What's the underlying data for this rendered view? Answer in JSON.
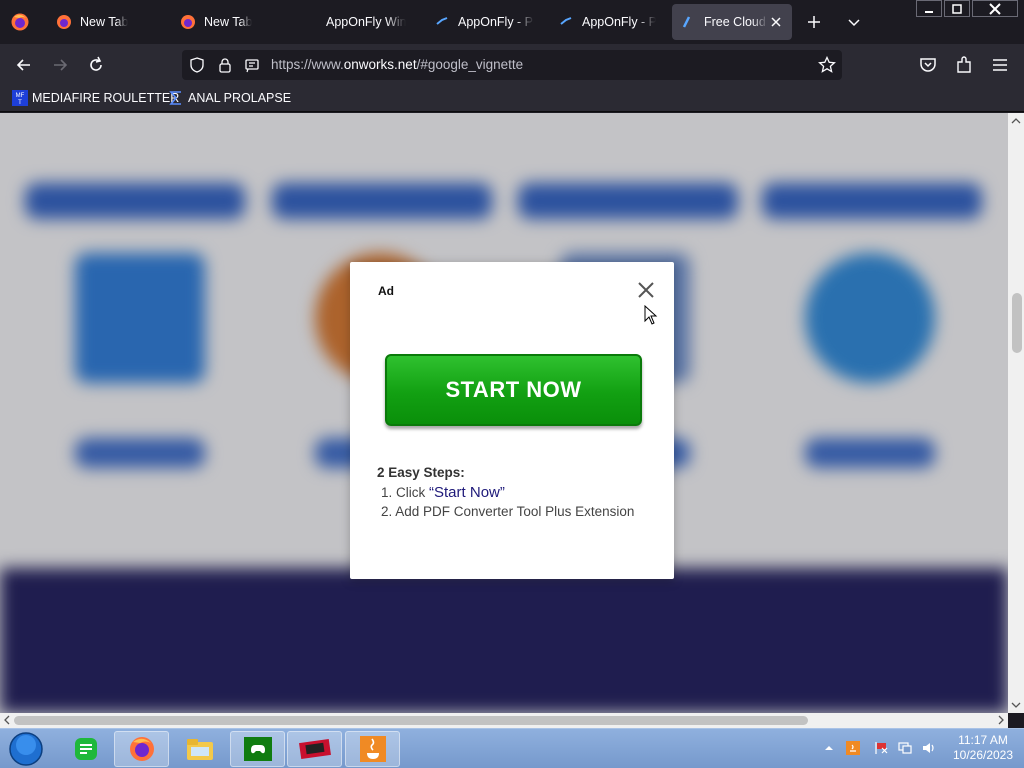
{
  "browser": {
    "tabs": [
      {
        "title": "New Tab",
        "icon": "firefox-icon",
        "active": false
      },
      {
        "title": "New Tab",
        "icon": "firefox-icon",
        "active": false
      },
      {
        "title": "AppOnFly Windows",
        "icon": "none",
        "active": false
      },
      {
        "title": "AppOnFly - Port",
        "icon": "apponfly-icon",
        "active": false
      },
      {
        "title": "AppOnFly - Port",
        "icon": "apponfly-icon",
        "active": false
      },
      {
        "title": "Free Cloud Hosting",
        "icon": "apponfly-icon",
        "active": true
      }
    ],
    "url_prefix": "https://www.",
    "url_host": "onworks.net",
    "url_suffix": "/#google_vignette",
    "bookmarks": [
      {
        "label": "MEDIAFIRE ROULETTER",
        "icon": "mft-icon"
      },
      {
        "label": "ANAL PROLAPSE",
        "icon": "sigma-icon"
      }
    ]
  },
  "ad_modal": {
    "ad_label": "Ad",
    "start_button": "START NOW",
    "steps_title": "2 Easy Steps:",
    "step1_prefix": "1. Click ",
    "step1_quote": "“Start Now”",
    "step2": "2. Add PDF Converter Tool Plus Extension"
  },
  "taskbar": {
    "apps": [
      "notes-icon",
      "firefox-icon",
      "file-explorer-icon",
      "xbox-icon",
      "media-icon",
      "java-icon"
    ],
    "time": "11:17 AM",
    "date": "10/26/2023"
  },
  "colors": {
    "accent_green": "#12a012",
    "modal_quote": "#1f1a7a",
    "browser_dark": "#1c1b22",
    "footer_band": "#1d1a5a"
  }
}
